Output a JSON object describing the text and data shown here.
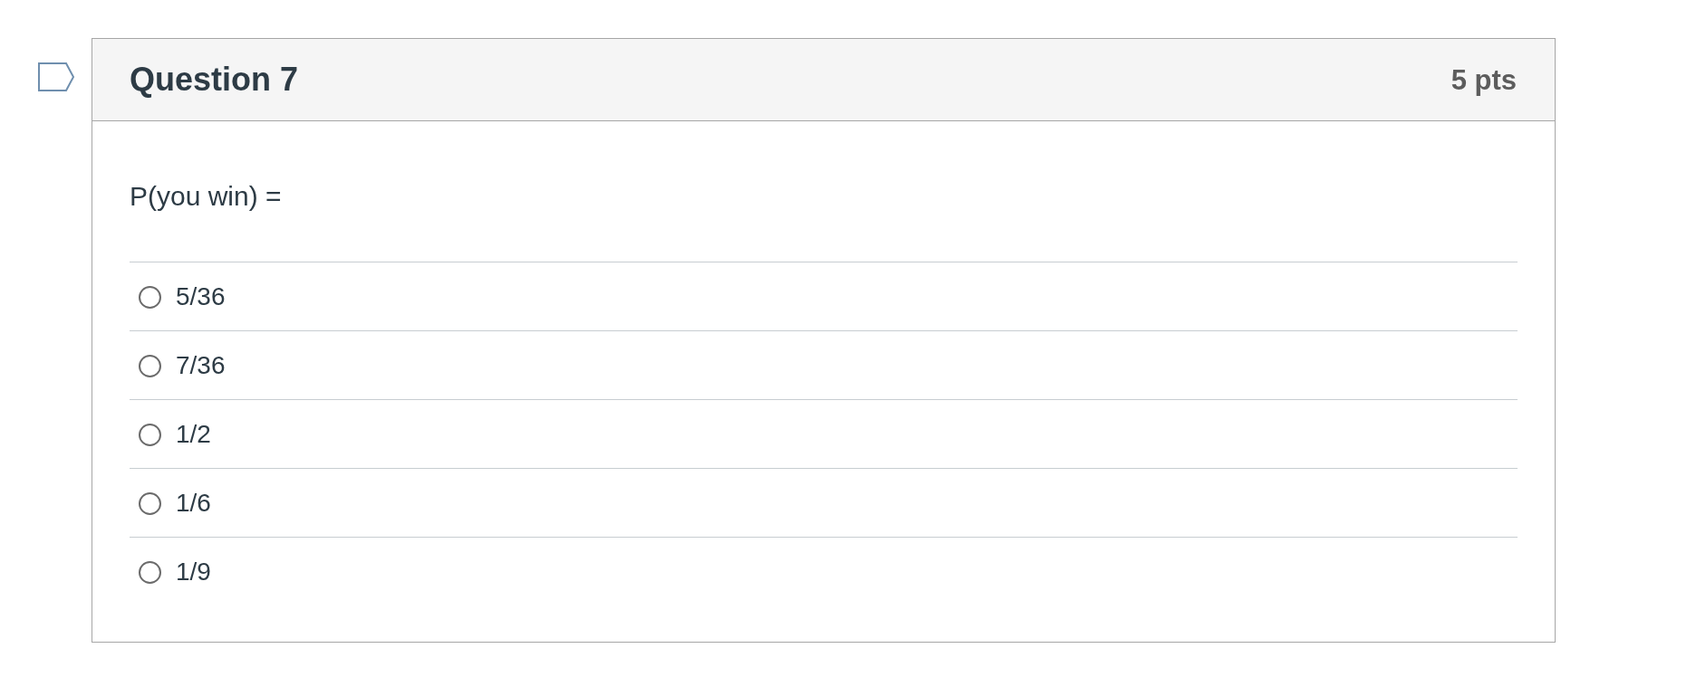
{
  "question": {
    "flagged": false,
    "title": "Question 7",
    "points": "5 pts",
    "text": "P(you win) =",
    "answers": [
      {
        "label": "5/36",
        "selected": false
      },
      {
        "label": "7/36",
        "selected": false
      },
      {
        "label": "1/2",
        "selected": false
      },
      {
        "label": "1/6",
        "selected": false
      },
      {
        "label": "1/9",
        "selected": false
      }
    ]
  }
}
